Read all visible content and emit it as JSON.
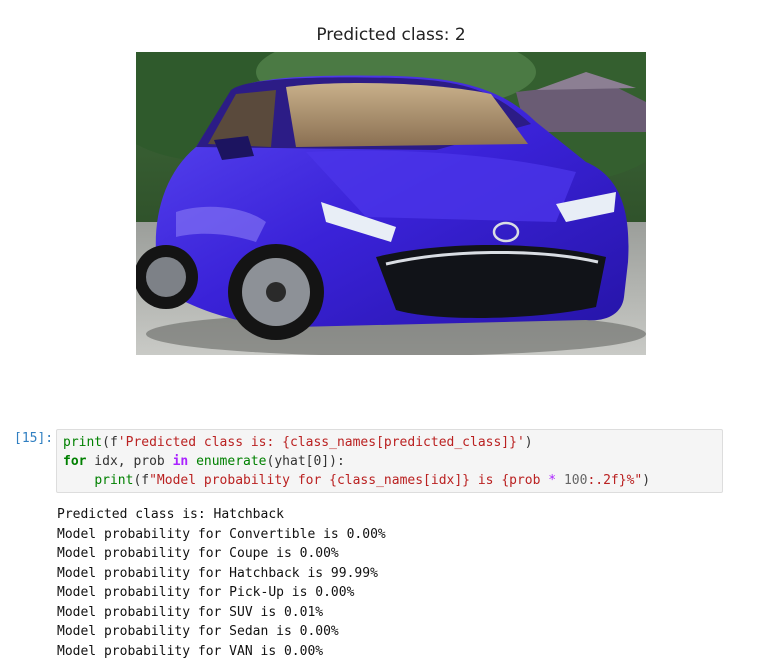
{
  "figure": {
    "title": "Predicted class: 2",
    "image_subject": "blue-hatchback-car-photo"
  },
  "cell": {
    "prompt": "[15]:",
    "code": {
      "line1": {
        "fn": "print",
        "open": "(f",
        "str": "'Predicted class is: {class_names[predicted_class]}'",
        "close": ")"
      },
      "line2": {
        "kw_for": "for",
        "vars": " idx, prob ",
        "kw_in": "in",
        "sp": " ",
        "fn": "enumerate",
        "rest": "(yhat[0]):"
      },
      "line3": {
        "indent": "    ",
        "fn": "print",
        "open": "(f",
        "str1": "\"Model probability for ",
        "brace1": "{class_names[idx]}",
        "str2": " is ",
        "brace2a": "{prob ",
        "op": "*",
        "sp": " ",
        "num": "100",
        "brace2b": ":.2f}",
        "str3": "%\"",
        "close": ")"
      }
    },
    "output_lines": [
      "Predicted class is: Hatchback",
      "Model probability for Convertible is 0.00%",
      "Model probability for Coupe is 0.00%",
      "Model probability for Hatchback is 99.99%",
      "Model probability for Pick-Up is 0.00%",
      "Model probability for SUV is 0.01%",
      "Model probability for Sedan is 0.00%",
      "Model probability for VAN is 0.00%"
    ]
  },
  "colors": {
    "prompt": "#307fc1",
    "cell_bg": "#f5f5f5",
    "car_body": "#3a22d8"
  }
}
